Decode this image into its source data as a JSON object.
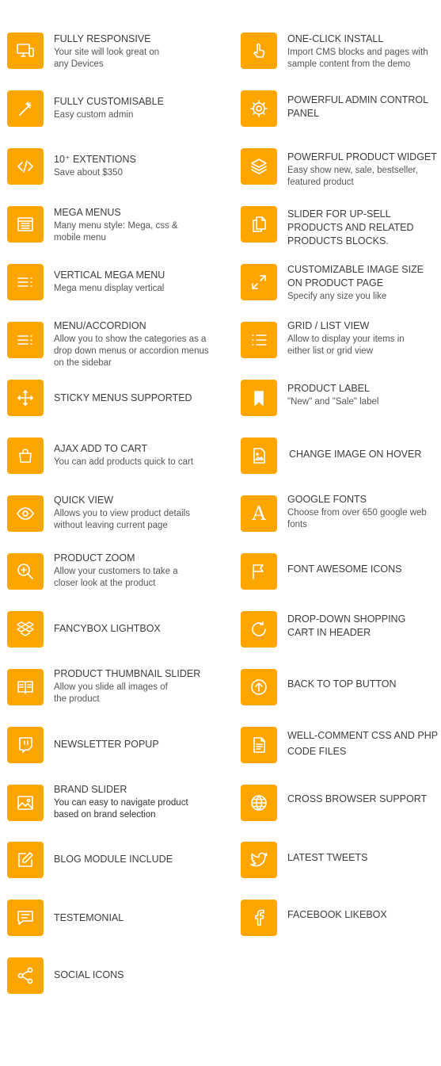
{
  "accent_color": "#ffa500",
  "left_column": [
    {
      "icon": "devices-icon",
      "title": "FULLY RESPONSIVE",
      "desc": "Your site will look great on any  Devices"
    },
    {
      "icon": "magic-wand-icon",
      "title": "FULLY CUSTOMISABLE",
      "desc": "Easy custom admin"
    },
    {
      "icon": "code-icon",
      "title": "10⁺ EXTENTIONS",
      "desc": "Save about $350"
    },
    {
      "icon": "mega-menu-icon",
      "title": "MEGA MENUS",
      "desc": "Many menu style: Mega, css & mobile menu"
    },
    {
      "icon": "vertical-menu-icon",
      "title": "VERTICAL MEGA MENU",
      "desc": "Mega menu display vertical"
    },
    {
      "icon": "accordion-menu-icon",
      "title": "MENU/ACCORDION",
      "desc": "Allow you to show the categories as a drop down menus or accordion menus on the sidebar"
    },
    {
      "icon": "move-arrows-icon",
      "title": "STICKY MENUS SUPPORTED",
      "desc": ""
    },
    {
      "icon": "shopping-bag-icon",
      "title": "AJAX ADD TO CART",
      "desc": "You can add products quick to cart"
    },
    {
      "icon": "eye-icon",
      "title": "QUICK VIEW",
      "desc": "Allows you to view product details without leaving current page"
    },
    {
      "icon": "zoom-in-icon",
      "title": "PRODUCT ZOOM",
      "desc": "Allow your customers to take a closer look at the product"
    },
    {
      "icon": "dropbox-icon",
      "title": "FANCYBOX LIGHTBOX",
      "desc": ""
    },
    {
      "icon": "book-icon",
      "title": "PRODUCT THUMBNAIL SLIDER",
      "desc": "Allow you slide all images of the product"
    },
    {
      "icon": "twitch-icon",
      "title": "NEWSLETTER POPUP",
      "desc": ""
    },
    {
      "icon": "image-icon",
      "title": "BRAND SLIDER",
      "desc": "You can easy to navigate product based on brand selection"
    },
    {
      "icon": "edit-icon",
      "title": "BLOG MODULE INCLUDE",
      "desc": ""
    },
    {
      "icon": "comment-icon",
      "title": "TESTEMONIAL",
      "desc": ""
    },
    {
      "icon": "share-icon",
      "title": "SOCIAL ICONS",
      "desc": ""
    }
  ],
  "right_column": [
    {
      "icon": "hand-pointer-icon",
      "title": "ONE-CLICK INSTALL",
      "desc": "Import CMS blocks and pages with sample content from the demo"
    },
    {
      "icon": "gear-icon",
      "title": "POWERFUL ADMIN CONTROL PANEL",
      "desc": ""
    },
    {
      "icon": "layers-icon",
      "title": "POWERFUL PRODUCT WIDGET",
      "desc": "Easy show new, sale, bestseller, featured product"
    },
    {
      "icon": "copy-files-icon",
      "title": "SLIDER FOR UP-SELL PRODUCTS AND RELATED PRODUCTS BLOCKS.",
      "desc": ""
    },
    {
      "icon": "expand-icon",
      "title": "CUSTOMIZABLE IMAGE SIZE ON PRODUCT PAGE",
      "desc": "Specify any size you like"
    },
    {
      "icon": "list-icon",
      "title": "GRID / LIST VIEW",
      "desc": "Allow to display your items in either list or grid view"
    },
    {
      "icon": "bookmark-icon",
      "title": "PRODUCT LABEL",
      "desc": "\"New\" and \"Sale\" label"
    },
    {
      "icon": "picture-file-icon",
      "title": "CHANGE IMAGE ON HOVER",
      "desc": ""
    },
    {
      "icon": "font-icon",
      "title": "GOOGLE FONTS",
      "desc": "Choose from over 650 google web fonts"
    },
    {
      "icon": "flag-icon",
      "title": "FONT AWESOME ICONS",
      "desc": ""
    },
    {
      "icon": "refresh-icon",
      "title": "DROP-DOWN SHOPPING CART IN HEADER",
      "desc": ""
    },
    {
      "icon": "arrow-up-circle-icon",
      "title": "BACK TO TOP BUTTON",
      "desc": ""
    },
    {
      "icon": "document-icon",
      "title": "WELL-COMMENT CSS AND PHP CODE FILES",
      "desc": ""
    },
    {
      "icon": "globe-icon",
      "title": "CROSS BROWSER SUPPORT",
      "desc": ""
    },
    {
      "icon": "twitter-icon",
      "title": "LATEST TWEETS",
      "desc": ""
    },
    {
      "icon": "facebook-icon",
      "title": "FACEBOOK LIKEBOX",
      "desc": ""
    }
  ]
}
